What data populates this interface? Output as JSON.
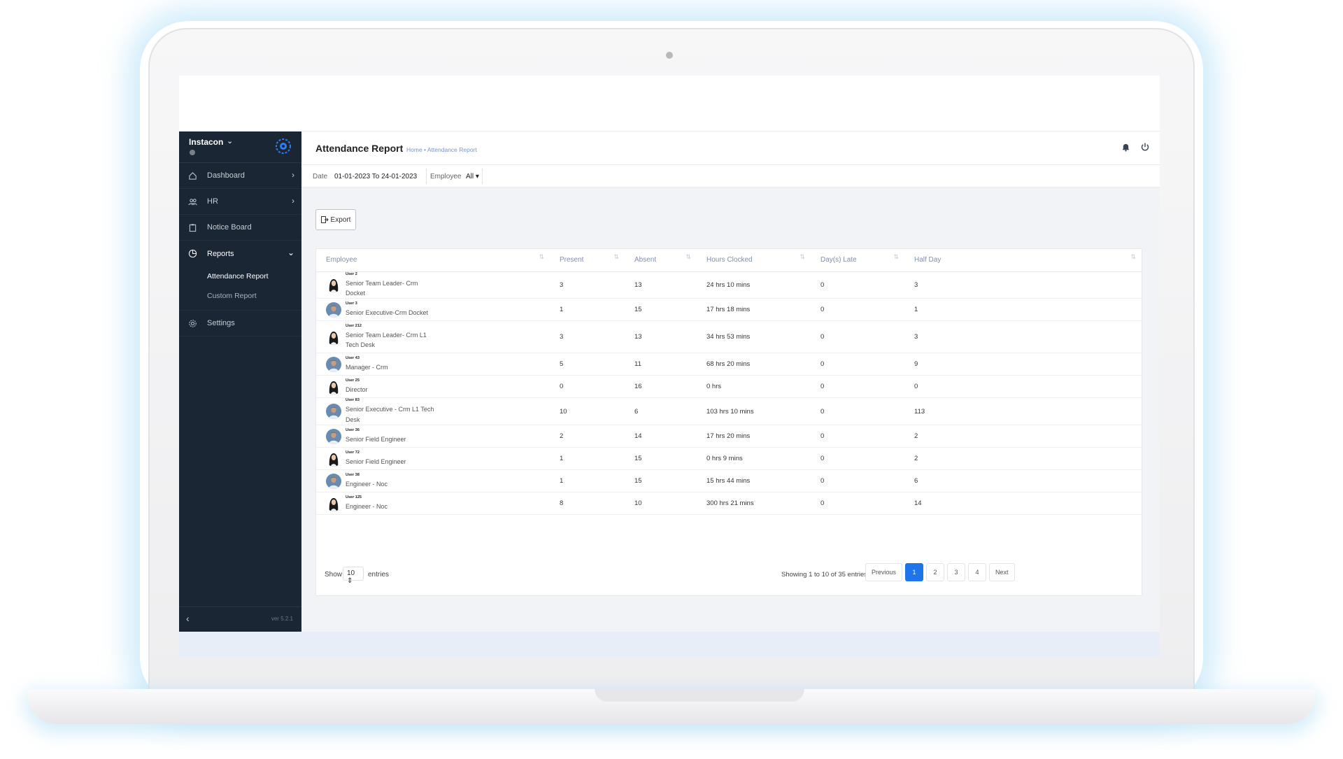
{
  "app": {
    "brand": "Instacon",
    "version": "ver 5.2.1"
  },
  "sidebar": {
    "items": [
      {
        "label": "Dashboard",
        "icon": "home-icon"
      },
      {
        "label": "HR",
        "icon": "users-icon"
      },
      {
        "label": "Notice Board",
        "icon": "clipboard-icon"
      },
      {
        "label": "Reports",
        "icon": "pie-chart-icon"
      },
      {
        "label": "Settings",
        "icon": "gear-icon"
      }
    ],
    "reports_sub": [
      "Attendance Report",
      "Custom Report"
    ]
  },
  "header": {
    "title": "Attendance Report",
    "breadcrumb": "Home • Attendance Report"
  },
  "filters": {
    "date_label": "Date",
    "date_value": "01-01-2023 To 24-01-2023",
    "employee_label": "Employee",
    "employee_value": "All ▾"
  },
  "toolbar": {
    "export_label": "Export"
  },
  "table": {
    "columns": [
      "Employee",
      "Present",
      "Absent",
      "Hours Clocked",
      "Day(s) Late",
      "Half Day"
    ],
    "rows": [
      {
        "name": "User 2",
        "role": "Senior Team Leader- Crm Docket",
        "avatar": "female",
        "present": "3",
        "absent": "13",
        "hours": "24 hrs 10 mins",
        "late": "0",
        "half": "3"
      },
      {
        "name": "User 3",
        "role": "Senior Executive-Crm Docket",
        "avatar": "male",
        "present": "1",
        "absent": "15",
        "hours": "17 hrs 18 mins",
        "late": "0",
        "half": "1"
      },
      {
        "name": "User 212",
        "role": "Senior Team Leader- Crm L1 Tech Desk",
        "avatar": "female",
        "present": "3",
        "absent": "13",
        "hours": "34 hrs 53 mins",
        "late": "0",
        "half": "3"
      },
      {
        "name": "User 43",
        "role": "Manager - Crm",
        "avatar": "male",
        "present": "5",
        "absent": "11",
        "hours": "68 hrs 20 mins",
        "late": "0",
        "half": "9"
      },
      {
        "name": "User 25",
        "role": "Director",
        "avatar": "female",
        "present": "0",
        "absent": "16",
        "hours": "0 hrs",
        "late": "0",
        "half": "0"
      },
      {
        "name": "User 83",
        "role": "Senior Executive - Crm L1 Tech Desk",
        "avatar": "male",
        "present": "10",
        "absent": "6",
        "hours": "103 hrs 10 mins",
        "late": "0",
        "half": "113"
      },
      {
        "name": "User 36",
        "role": "Senior Field Engineer",
        "avatar": "male",
        "present": "2",
        "absent": "14",
        "hours": "17 hrs 20 mins",
        "late": "0",
        "half": "2"
      },
      {
        "name": "User 72",
        "role": "Senior Field Engineer",
        "avatar": "female",
        "present": "1",
        "absent": "15",
        "hours": "0 hrs 9 mins",
        "late": "0",
        "half": "2"
      },
      {
        "name": "User 38",
        "role": "Engineer - Noc",
        "avatar": "male",
        "present": "1",
        "absent": "15",
        "hours": "15 hrs 44 mins",
        "late": "0",
        "half": "6"
      },
      {
        "name": "User 125",
        "role": "Engineer - Noc",
        "avatar": "female",
        "present": "8",
        "absent": "10",
        "hours": "300 hrs 21 mins",
        "late": "0",
        "half": "14"
      }
    ]
  },
  "footer": {
    "show_label": "Show",
    "page_size": "10",
    "entries_label": "entries",
    "showing": "Showing 1 to 10 of 35 entries",
    "prev": "Previous",
    "next": "Next",
    "pages": [
      "1",
      "2",
      "3",
      "4"
    ],
    "current_page": "1"
  },
  "colors": {
    "sidebar_bg": "#1b2634",
    "accent": "#1e74e8",
    "main_bg": "#f1f3f6"
  }
}
